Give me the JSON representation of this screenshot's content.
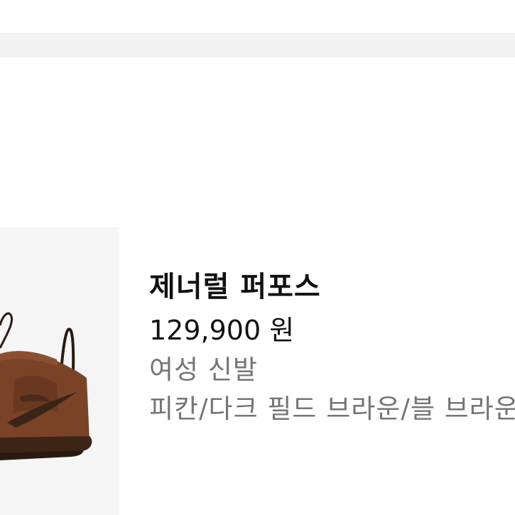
{
  "product": {
    "name": "제너럴 퍼포스",
    "price": "129,900 원",
    "category": "여성 신발",
    "colors": "피칸/다크 필드 브라운/블 브라운"
  },
  "colors": {
    "band": "#f3f3f3",
    "image_background": "#f5f5f5",
    "primary_text": "#111111",
    "secondary_text": "#757575",
    "shoe_brown": "#6b3a22",
    "shoe_dark": "#3a2418"
  }
}
